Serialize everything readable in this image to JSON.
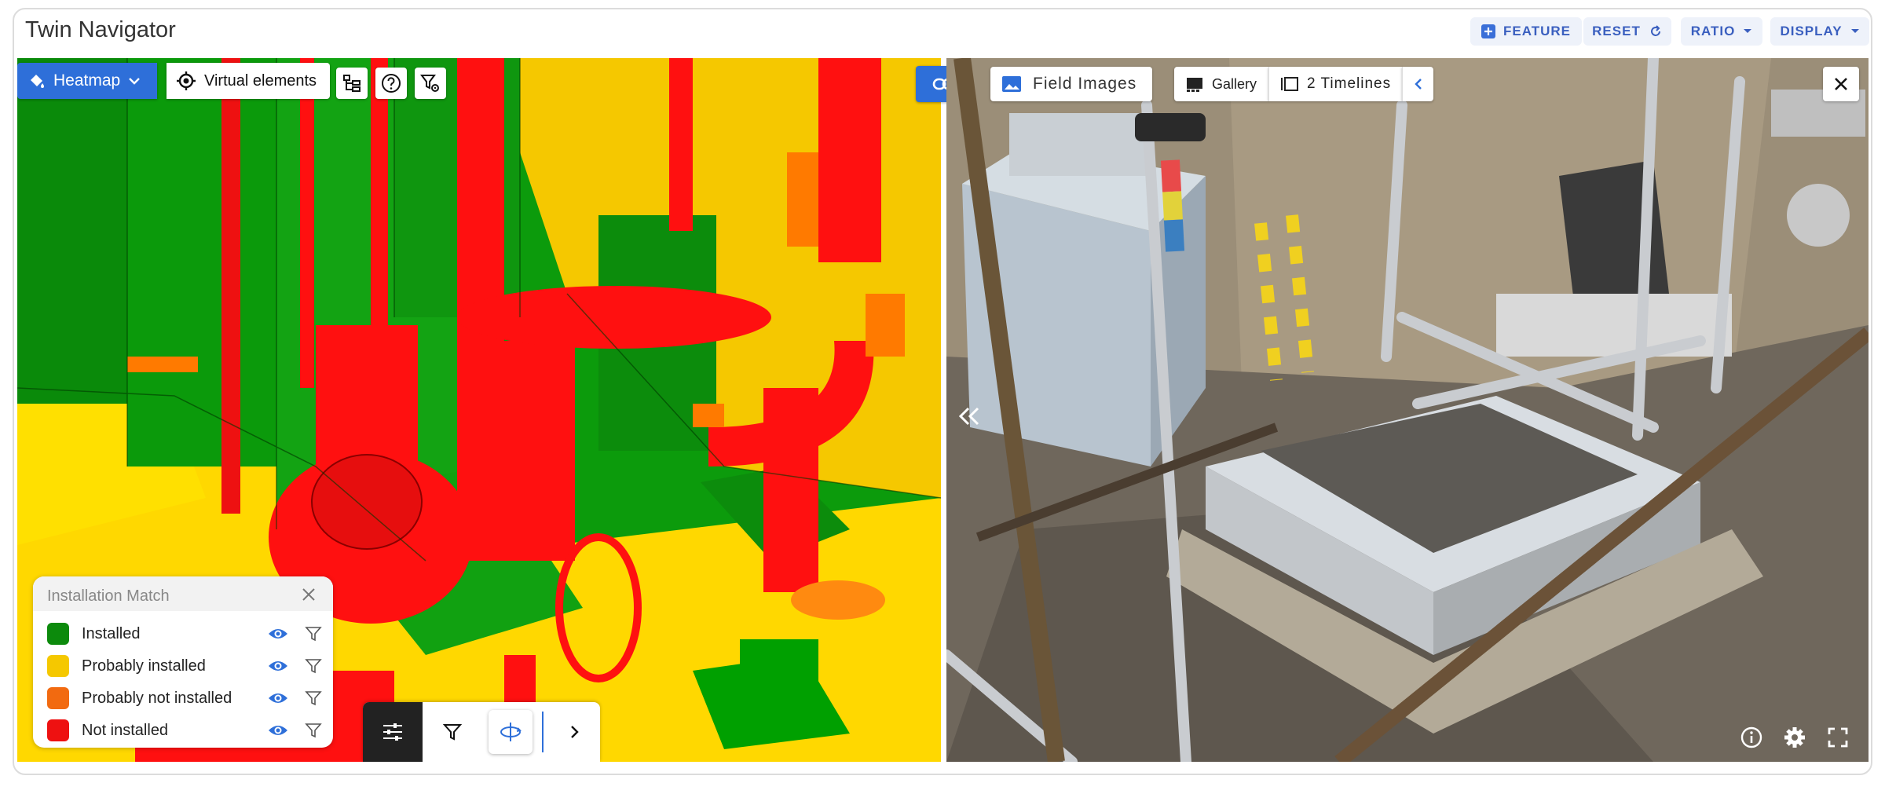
{
  "app": {
    "title": "Twin Navigator"
  },
  "top_actions": {
    "feature_label": "FEATURE",
    "reset_label": "RESET",
    "ratio_label": "RATIO",
    "display_label": "DISPLAY"
  },
  "model_toolbar": {
    "heatmap_label": "Heatmap",
    "virtual_elements_label": "Virtual elements"
  },
  "legend": {
    "title": "Installation Match",
    "items": [
      {
        "label": "Installed",
        "color": "#0c8a0c"
      },
      {
        "label": "Probably installed",
        "color": "#f5c800"
      },
      {
        "label": "Probably not installed",
        "color": "#f26a10"
      },
      {
        "label": "Not installed",
        "color": "#ee1111"
      }
    ]
  },
  "images_toolbar": {
    "field_images_label": "Field Images",
    "gallery_label": "Gallery",
    "timelines_label": "2 Timelines"
  },
  "colors": {
    "accent": "#2e6fd9",
    "installed": "#0c8a0c",
    "probably_installed": "#f5c800",
    "probably_not_installed": "#f26a10",
    "not_installed": "#ee1111"
  }
}
